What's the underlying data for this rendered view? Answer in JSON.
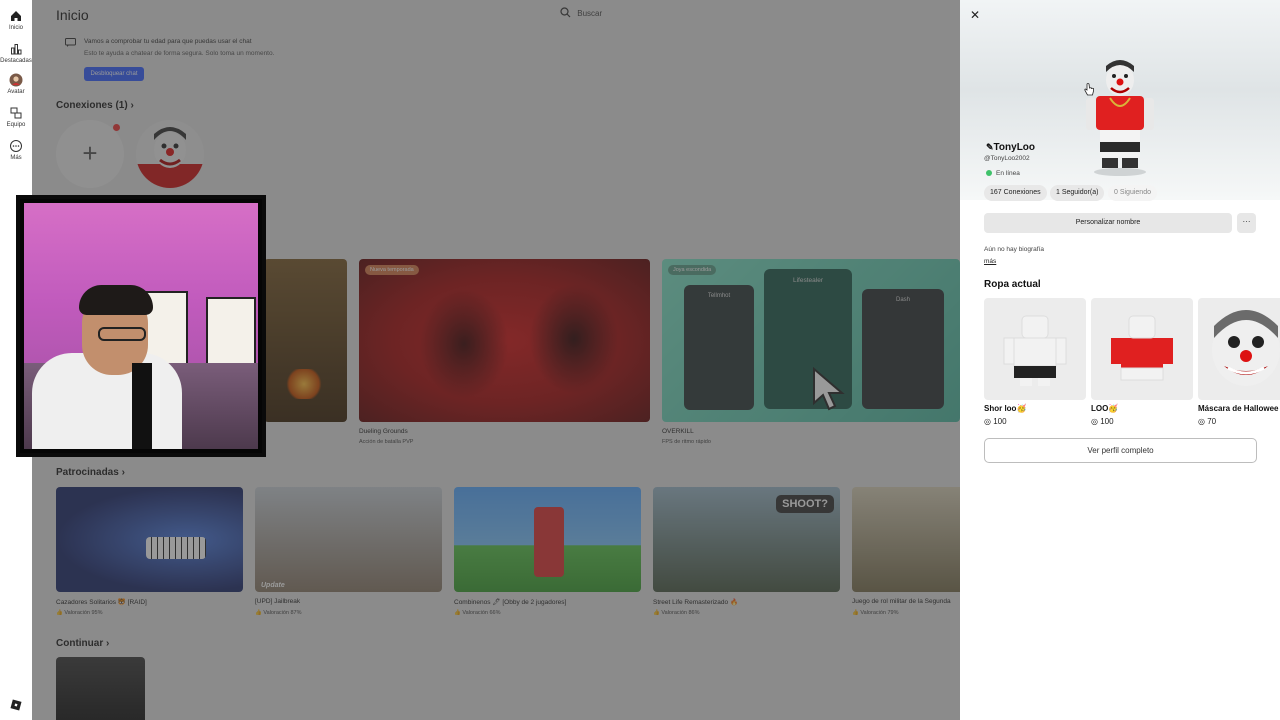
{
  "nav": {
    "items": [
      {
        "label": "Inicio",
        "icon": "home-icon"
      },
      {
        "label": "Destacadas",
        "icon": "chart-icon"
      },
      {
        "label": "Avatar",
        "icon": "avatar-icon"
      },
      {
        "label": "Equipo",
        "icon": "team-icon"
      },
      {
        "label": "Más",
        "icon": "more-icon"
      }
    ]
  },
  "header": {
    "title": "Inicio",
    "search_placeholder": "Buscar"
  },
  "age_notice": {
    "title": "Vamos a comprobar tu edad para que puedas usar el chat",
    "body": "Esto te ayuda a chatear de forma segura. Solo toma un momento.",
    "button": "Desbloquear chat"
  },
  "connections": {
    "title": "Conexiones (1)"
  },
  "games_row": [
    {
      "title": "Dueling Grounds",
      "sub": "Acción de batalla PVP",
      "badge": "Nueva temporada"
    },
    {
      "title": "OVERKILL",
      "sub": "FPS de ritmo rápido",
      "badge": "Joya escondida"
    }
  ],
  "overkill_labels": [
    "Tellmhot",
    "Lifestealer",
    "Dash"
  ],
  "sponsored": {
    "title": "Patrocinadas",
    "items": [
      {
        "title": "Cazadores Solitarios 🐯 [RAID]",
        "rating": "Valoración 95%"
      },
      {
        "title": "[UPD] Jailbreak",
        "rating": "Valoración 87%",
        "badge": "Update"
      },
      {
        "title": "Combinenos 🖊 [Obby de 2 jugadores]",
        "rating": "Valoración 66%"
      },
      {
        "title": "Street Life Remasterizado 🔥",
        "rating": "Valoración 86%",
        "badge": "SHOOT?"
      },
      {
        "title": "Juego de rol militar de la Segunda",
        "rating": "Valoración 79%"
      }
    ]
  },
  "continue": {
    "title": "Continuar"
  },
  "profile": {
    "display_name": "TonyLoo",
    "username": "@TonyLoo2002",
    "status": "En línea",
    "stats": [
      "167 Conexiones",
      "1 Seguidor(a)",
      "0 Siguiendo"
    ],
    "customize_button": "Personalizar nombre",
    "more_button": "···",
    "bio": "Aún no hay biografía",
    "bio_more": "más",
    "outfit_title": "Ropa actual",
    "items": [
      {
        "name": "Shor loo🥳",
        "price": "100"
      },
      {
        "name": "LOO🥳",
        "price": "100"
      },
      {
        "name": "Máscara de Hallowee",
        "price": "70"
      }
    ],
    "full_profile_button": "Ver perfil completo"
  },
  "colors": {
    "accent": "#335fff",
    "online": "#3fc26a",
    "webcam_bg": "#c966c2"
  }
}
